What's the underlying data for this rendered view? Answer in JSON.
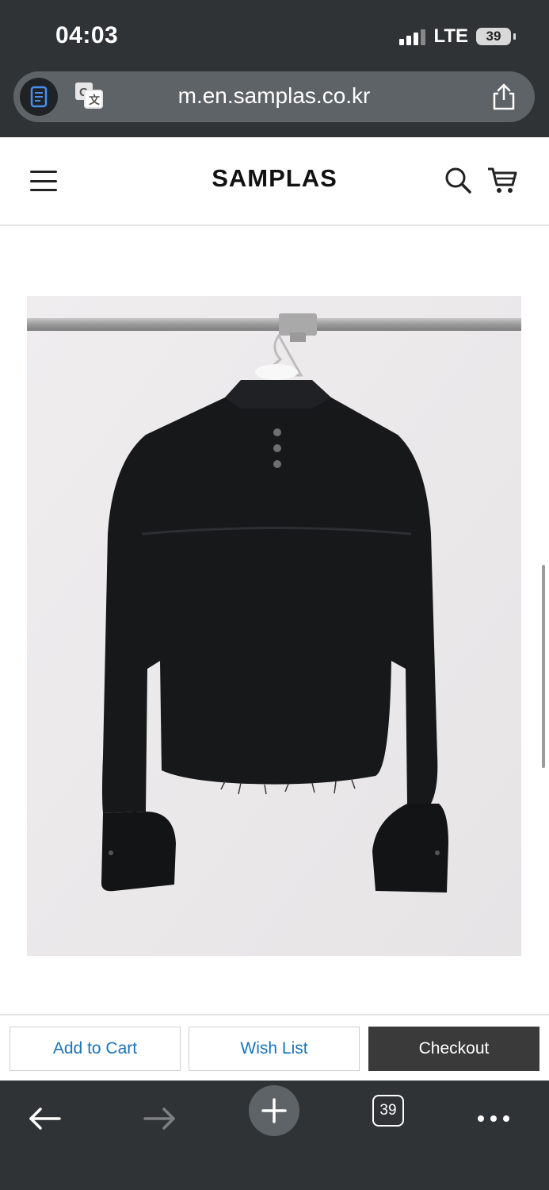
{
  "status_bar": {
    "time": "04:03",
    "network": "LTE",
    "battery": "39"
  },
  "browser": {
    "url": "m.en.samplas.co.kr",
    "tab_count": "39"
  },
  "site": {
    "brand": "SAMPLAS"
  },
  "actions": {
    "add_to_cart": "Add to Cart",
    "wish_list": "Wish List",
    "checkout": "Checkout"
  },
  "icons": {
    "reader": "reader-mode-icon",
    "translate": "translate-icon",
    "share": "share-icon",
    "menu": "hamburger-menu-icon",
    "search": "search-icon",
    "cart": "cart-icon",
    "back": "back-arrow-icon",
    "forward": "forward-arrow-icon",
    "new_tab": "plus-icon",
    "more": "more-dots-icon"
  },
  "colors": {
    "link": "#1a73b8",
    "checkout_bg": "#3a3a3a",
    "browser_chrome": "#303336"
  }
}
